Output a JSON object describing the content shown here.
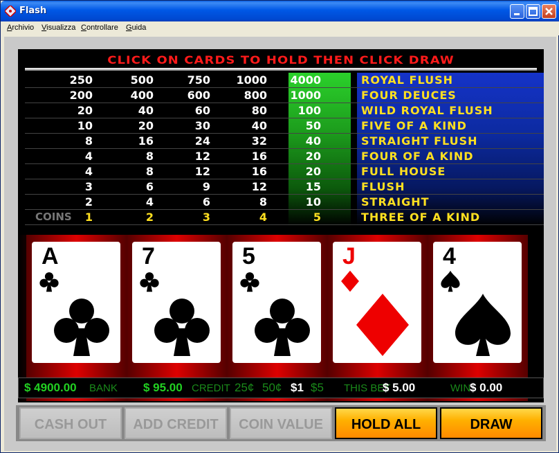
{
  "window": {
    "title": "Flash"
  },
  "menu": [
    {
      "label": "Archivio"
    },
    {
      "label": "Visualizza"
    },
    {
      "label": "Controllare"
    },
    {
      "label": "Guida"
    }
  ],
  "instruction": "CLICK ON CARDS TO HOLD THEN CLICK DRAW",
  "paytable": {
    "highlight_column": 4,
    "rows": [
      {
        "values": [
          "250",
          "500",
          "750",
          "1000",
          "4000"
        ],
        "hand": "ROYAL FLUSH"
      },
      {
        "values": [
          "200",
          "400",
          "600",
          "800",
          "1000"
        ],
        "hand": "FOUR DEUCES"
      },
      {
        "values": [
          "20",
          "40",
          "60",
          "80",
          "100"
        ],
        "hand": "WILD ROYAL FLUSH"
      },
      {
        "values": [
          "10",
          "20",
          "30",
          "40",
          "50"
        ],
        "hand": "FIVE OF A KIND"
      },
      {
        "values": [
          "8",
          "16",
          "24",
          "32",
          "40"
        ],
        "hand": "STRAIGHT FLUSH"
      },
      {
        "values": [
          "4",
          "8",
          "12",
          "16",
          "20"
        ],
        "hand": "FOUR OF A KIND"
      },
      {
        "values": [
          "4",
          "8",
          "12",
          "16",
          "20"
        ],
        "hand": "FULL HOUSE"
      },
      {
        "values": [
          "3",
          "6",
          "9",
          "12",
          "15"
        ],
        "hand": "FLUSH"
      },
      {
        "values": [
          "2",
          "4",
          "6",
          "8",
          "10"
        ],
        "hand": "STRAIGHT"
      }
    ],
    "coins_label": "COINS",
    "coins_row": {
      "values": [
        "1",
        "2",
        "3",
        "4",
        "5"
      ],
      "hand": "THREE OF A KIND"
    }
  },
  "cards": [
    {
      "rank": "A",
      "suit": "clubs",
      "color": "black"
    },
    {
      "rank": "7",
      "suit": "clubs",
      "color": "black"
    },
    {
      "rank": "5",
      "suit": "clubs",
      "color": "black"
    },
    {
      "rank": "J",
      "suit": "diamonds",
      "color": "red"
    },
    {
      "rank": "4",
      "suit": "spades",
      "color": "black"
    }
  ],
  "status": {
    "bank_amount": "$ 4900.00",
    "bank_label": "BANK",
    "credit_amount": "$ 95.00",
    "credit_label": "CREDIT",
    "denom_25": "25¢",
    "denom_50": "50¢",
    "denom_1": "$1",
    "denom_5": "$5",
    "bet_label": "THIS BET",
    "bet_amount": "$ 5.00",
    "win_label": "WIN",
    "win_amount": "$ 0.00"
  },
  "buttons": [
    {
      "label": "CASH OUT",
      "state": "disabled"
    },
    {
      "label": "ADD CREDIT",
      "state": "disabled"
    },
    {
      "label": "COIN VALUE",
      "state": "disabled"
    },
    {
      "label": "HOLD ALL",
      "state": "active"
    },
    {
      "label": "DRAW",
      "state": "active"
    }
  ]
}
